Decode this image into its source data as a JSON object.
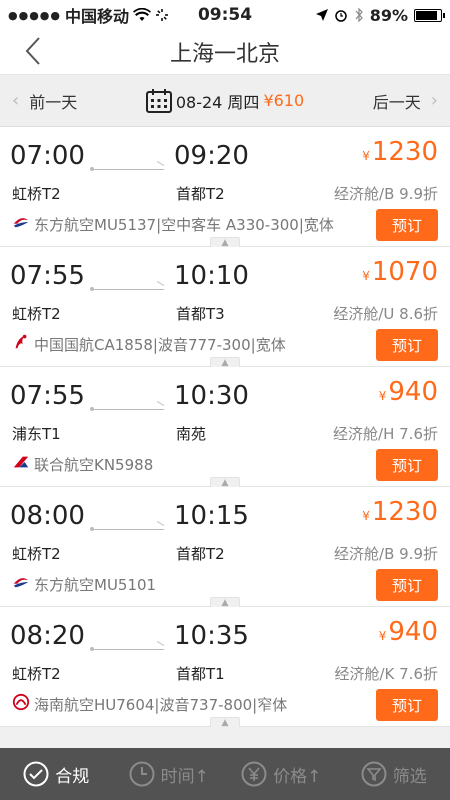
{
  "status": {
    "carrier": "中国移动",
    "time": "09:54",
    "battery": "89%",
    "battery_level": 0.89
  },
  "nav": {
    "back_icon": "chevron-left-icon",
    "title": "上海一北京"
  },
  "datebar": {
    "prev_label": "前一天",
    "date": "08-24 周四",
    "lowest_price": "¥610",
    "next_label": "后一天"
  },
  "flights": [
    {
      "dep_time": "07:00",
      "arr_time": "09:20",
      "dep_airport": "虹桥T2",
      "arr_airport": "首都T2",
      "price": "1230",
      "cabin": "经济舱/B 9.9折",
      "airline": "东方航空MU5137|空中客车 A330-300|宽体",
      "logo": "china-eastern",
      "book": "预订"
    },
    {
      "dep_time": "07:55",
      "arr_time": "10:10",
      "dep_airport": "虹桥T2",
      "arr_airport": "首都T3",
      "price": "1070",
      "cabin": "经济舱/U 8.6折",
      "airline": "中国国航CA1858|波音777-300|宽体",
      "logo": "air-china",
      "book": "预订"
    },
    {
      "dep_time": "07:55",
      "arr_time": "10:30",
      "dep_airport": "浦东T1",
      "arr_airport": "南苑",
      "price": "940",
      "cabin": "经济舱/H 7.6折",
      "airline": "联合航空KN5988",
      "logo": "china-united",
      "book": "预订"
    },
    {
      "dep_time": "08:00",
      "arr_time": "10:15",
      "dep_airport": "虹桥T2",
      "arr_airport": "首都T2",
      "price": "1230",
      "cabin": "经济舱/B 9.9折",
      "airline": "东方航空MU5101",
      "logo": "china-eastern",
      "book": "预订"
    },
    {
      "dep_time": "08:20",
      "arr_time": "10:35",
      "dep_airport": "虹桥T2",
      "arr_airport": "首都T1",
      "price": "940",
      "cabin": "经济舱/K 7.6折",
      "airline": "海南航空HU7604|波音737-800|窄体",
      "logo": "hainan",
      "book": "预订"
    }
  ],
  "currency_symbol": "¥",
  "tabbar": [
    {
      "label": "合规",
      "icon": "check-circle-icon",
      "active": true
    },
    {
      "label": "时间↑",
      "icon": "clock-icon",
      "active": false
    },
    {
      "label": "价格↑",
      "icon": "yen-circle-icon",
      "active": false
    },
    {
      "label": "筛选",
      "icon": "filter-icon",
      "active": false
    }
  ],
  "colors": {
    "accent": "#ff6a1a",
    "tabbar_bg": "#464646"
  }
}
